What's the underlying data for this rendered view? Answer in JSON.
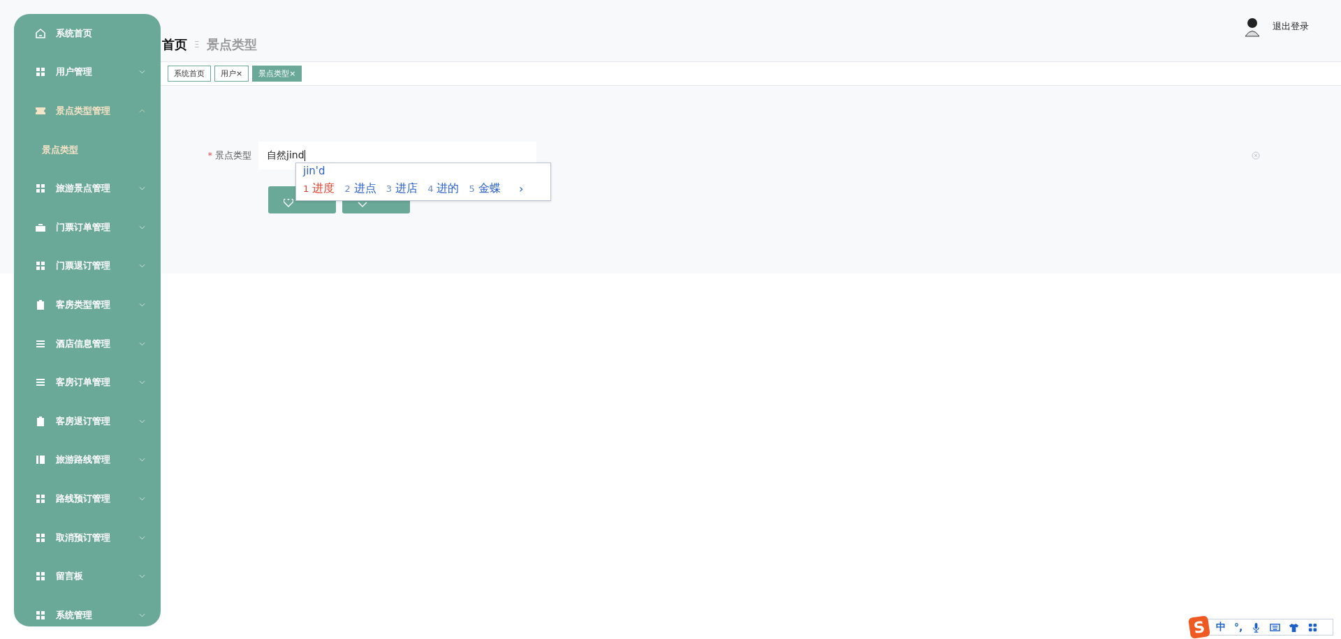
{
  "sidebar": {
    "items": [
      {
        "label": "系统首页"
      },
      {
        "label": "用户管理",
        "expandable": true,
        "expanded": false
      },
      {
        "label": "景点类型管理",
        "expandable": true,
        "expanded": true,
        "children": [
          {
            "label": "景点类型",
            "selected": true
          }
        ]
      },
      {
        "label": "旅游景点管理",
        "expandable": true,
        "expanded": false
      },
      {
        "label": "门票订单管理",
        "expandable": true,
        "expanded": false
      },
      {
        "label": "门票退订管理",
        "expandable": true,
        "expanded": false
      },
      {
        "label": "客房类型管理",
        "expandable": true,
        "expanded": false
      },
      {
        "label": "酒店信息管理",
        "expandable": true,
        "expanded": false
      },
      {
        "label": "客房订单管理",
        "expandable": true,
        "expanded": false
      },
      {
        "label": "客房退订管理",
        "expandable": true,
        "expanded": false
      },
      {
        "label": "旅游路线管理",
        "expandable": true,
        "expanded": false
      },
      {
        "label": "路线预订管理",
        "expandable": true,
        "expanded": false
      },
      {
        "label": "取消预订管理",
        "expandable": true,
        "expanded": false
      },
      {
        "label": "留言板",
        "expandable": true,
        "expanded": false
      },
      {
        "label": "系统管理",
        "expandable": true,
        "expanded": false
      }
    ]
  },
  "breadcrumb": {
    "items": [
      "首页",
      "景点类型"
    ],
    "separator": "Ξ"
  },
  "tabs": [
    {
      "label": "系统首页",
      "selected": false
    },
    {
      "label": "用户",
      "close": "×",
      "selected": false
    },
    {
      "label": "景点类型",
      "close": "×",
      "selected": true
    }
  ],
  "header": {
    "logout": "退出登录"
  },
  "form": {
    "label": "景点类型",
    "required_mark": "*",
    "value": "自然jind"
  },
  "ime_popup": {
    "composition": "jin'd",
    "candidates": [
      {
        "index": "1",
        "text": "进度",
        "selected": true
      },
      {
        "index": "2",
        "text": "进点",
        "selected": false
      },
      {
        "index": "3",
        "text": "进店",
        "selected": false
      },
      {
        "index": "4",
        "text": "进的",
        "selected": false
      },
      {
        "index": "5",
        "text": "金蝶",
        "selected": false
      }
    ],
    "next": "›"
  },
  "ime_bar": {
    "logo": "S",
    "mode": "中",
    "punct": "°,"
  }
}
